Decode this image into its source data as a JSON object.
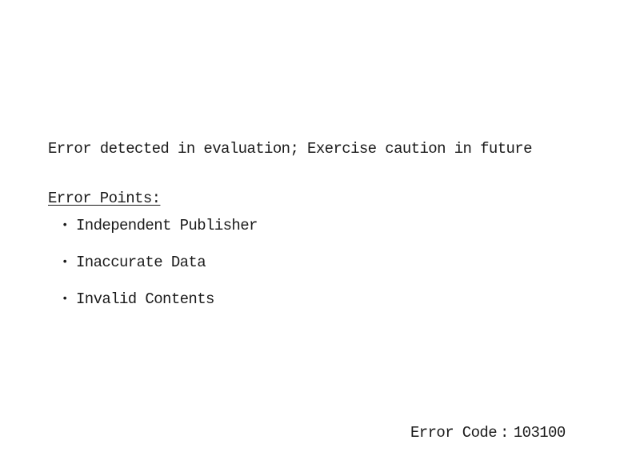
{
  "message": "Error detected in evaluation; Exercise caution in future",
  "error_points": {
    "heading": "Error Points:",
    "items": [
      "Independent Publisher",
      "Inaccurate Data",
      "Invalid Contents"
    ]
  },
  "error_code": {
    "label": "Error Code",
    "separator": ":",
    "value": "103100"
  }
}
